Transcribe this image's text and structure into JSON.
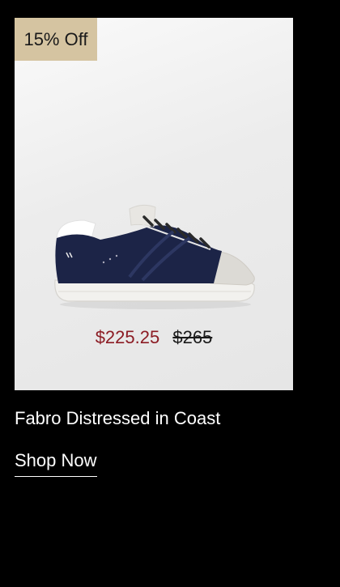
{
  "product": {
    "badge": "15% Off",
    "sale_price": "$225.25",
    "original_price": "$265",
    "title": "Fabro Distressed in Coast",
    "cta_label": "Shop Now"
  },
  "colors": {
    "page_background": "#000000",
    "badge_background": "#d5c4a1",
    "sale_price": "#8c1c24",
    "shoe_suede": "#1c2447"
  }
}
